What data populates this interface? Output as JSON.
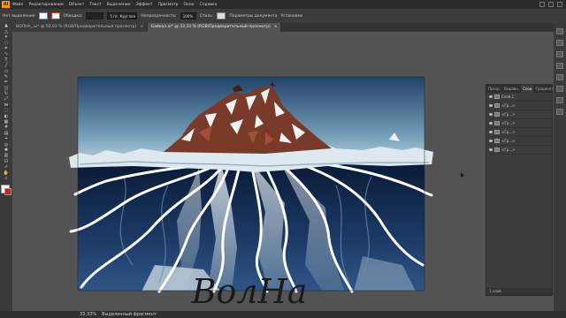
{
  "app": {
    "logo": "Ai"
  },
  "menu": [
    "Файл",
    "Редактирование",
    "Объект",
    "Текст",
    "Выделение",
    "Эффект",
    "Просмотр",
    "Окно",
    "Справка"
  ],
  "control": {
    "selection_label": "Нет выделения",
    "stroke_label": "Обводка:",
    "brush_value": "5 пт. Круглая",
    "opacity_label": "Непрозрачность:",
    "opacity_value": "100%",
    "style_label": "Стиль:",
    "doc_settings": "Параметры документа",
    "prefs": "Установки"
  },
  "tabs": [
    {
      "label": "ВОЛНА_.ai* @ 50,03 % (RGB/Предварительный просмотр)",
      "active": false
    },
    {
      "label": "Байкал.ai* @ 33,33 % (RGB/Предварительный просмотр)",
      "active": true
    }
  ],
  "panel": {
    "tabs": [
      "Прозр.",
      "Выравн.",
      "Слои",
      "Градиент"
    ],
    "active_tab": "Слои",
    "layers": [
      "Слой 1",
      "<Гр...>",
      "<Гр...>",
      "<Гр...>",
      "<Гр...>",
      "<Гр...>",
      "<Гр...>"
    ],
    "footer": "1 слой"
  },
  "status": {
    "zoom": "33,33%",
    "mode": "Выделенный фрагмент"
  },
  "artwork": {
    "word": "ВолНа"
  },
  "colors": {
    "accent": "#ff9a00",
    "sky_top": "#1f3d62",
    "sky_bottom": "#a9c8d6",
    "water": "#0d2142"
  }
}
